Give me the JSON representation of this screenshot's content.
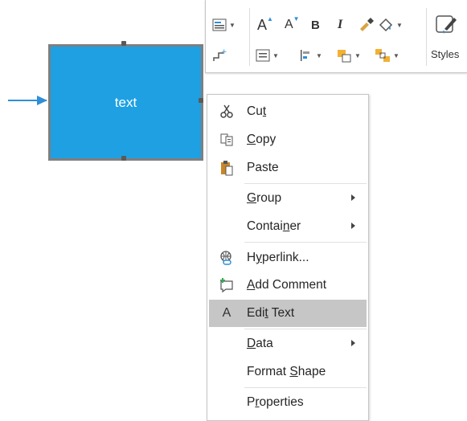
{
  "shape": {
    "text": "text"
  },
  "toolbar": {
    "styles_label": "Styles",
    "font_size_up_label": "A",
    "font_size_down_label": "A",
    "bold_label": "B",
    "italic_label": "I"
  },
  "menu": {
    "items": [
      {
        "pre": "Cu",
        "ul": "t",
        "post": "",
        "icon": "scissors-icon"
      },
      {
        "pre": "",
        "ul": "C",
        "post": "opy",
        "icon": "copy-icon"
      },
      {
        "pre": "Paste",
        "ul": "",
        "post": "",
        "icon": "paste-icon"
      },
      {
        "pre": "",
        "ul": "G",
        "post": "roup",
        "icon": ""
      },
      {
        "pre": "Contai",
        "ul": "n",
        "post": "er",
        "icon": ""
      },
      {
        "pre": "H",
        "ul": "y",
        "post": "perlink...",
        "icon": "hyperlink-icon"
      },
      {
        "pre": "",
        "ul": "A",
        "post": "dd Comment",
        "icon": "add-comment-icon"
      },
      {
        "pre": "Edi",
        "ul": "t",
        "post": " Text",
        "icon": "edit-text-icon"
      },
      {
        "pre": "",
        "ul": "D",
        "post": "ata",
        "icon": ""
      },
      {
        "pre": "Format ",
        "ul": "S",
        "post": "hape",
        "icon": ""
      },
      {
        "pre": "P",
        "ul": "r",
        "post": "operties",
        "icon": ""
      }
    ],
    "edit_text_icon_glyph": "A"
  },
  "colors": {
    "shape_fill": "#1ea0e2",
    "shape_border": "#7f7f7f",
    "connector": "#2e8fd8",
    "menu_highlight": "#c6c6c6"
  }
}
